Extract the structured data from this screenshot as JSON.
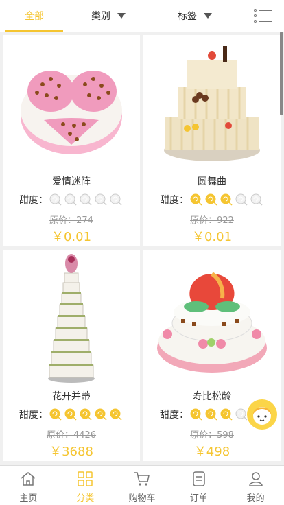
{
  "tabs": [
    {
      "label": "全部"
    },
    {
      "label": "类别"
    },
    {
      "label": "标签"
    }
  ],
  "sweet_label": "甜度：",
  "colors": {
    "accent": "#f5c531",
    "inactive": "#cccccc"
  },
  "products": [
    {
      "name": "爱情迷阵",
      "sweetness": 0,
      "original_price": "原价：274",
      "price": "￥0.01"
    },
    {
      "name": "圆舞曲",
      "sweetness": 3,
      "original_price": "原价：922",
      "price": "￥0.01"
    },
    {
      "name": "花开并蒂",
      "sweetness": 5,
      "original_price": "原价：4426",
      "price": "￥3688"
    },
    {
      "name": "寿比松龄",
      "sweetness": 3,
      "original_price": "原价：598",
      "price": "￥498"
    }
  ],
  "bottom_nav": [
    {
      "label": "主页",
      "icon": "home-icon"
    },
    {
      "label": "分类",
      "icon": "category-icon"
    },
    {
      "label": "购物车",
      "icon": "cart-icon"
    },
    {
      "label": "订单",
      "icon": "order-icon"
    },
    {
      "label": "我的",
      "icon": "user-icon"
    }
  ]
}
